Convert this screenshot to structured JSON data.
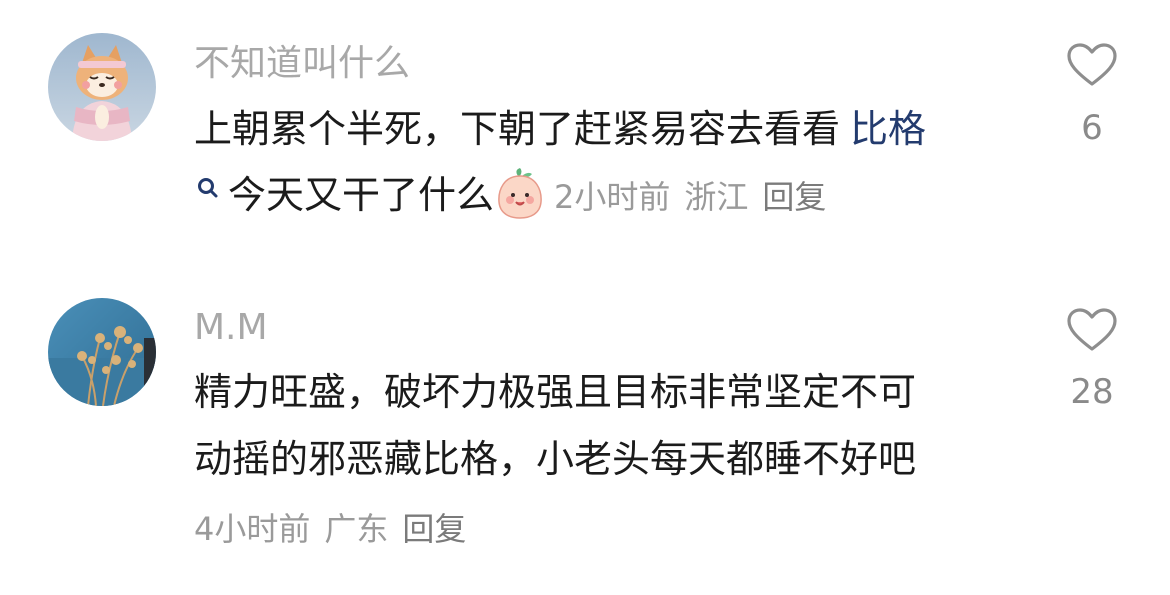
{
  "comments": [
    {
      "username": "不知道叫什么",
      "text_prefix": "上朝累个半死，下朝了赶紧易容去看看",
      "link_text": "比格",
      "search_text": "今天又干了什么",
      "time": "2小时前",
      "location": "浙江",
      "reply_label": "回复",
      "likes": "6",
      "avatar_icon": "shiba-dog-avatar",
      "emoji_icon": "peach-smile-emoji"
    },
    {
      "username": "M.M",
      "text_line1": "精力旺盛，破坏力极强且目标非常坚定不可",
      "text_line2": "动摇的邪恶藏比格，小老头每天都睡不好吧",
      "time": "4小时前",
      "location": "广东",
      "reply_label": "回复",
      "likes": "28",
      "avatar_icon": "sea-plants-avatar"
    }
  ],
  "colors": {
    "username": "#a8a8a8",
    "text": "#1b1b1b",
    "link": "#233b6e",
    "meta": "#9a9a9a",
    "heart_outline": "#8e8e8e"
  }
}
